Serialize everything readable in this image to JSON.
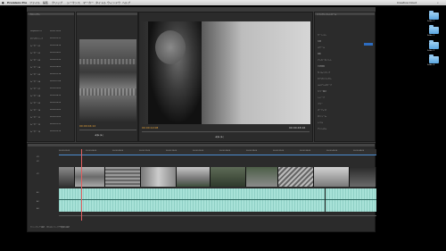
{
  "app": {
    "name": "Premiere Pro",
    "clock_label": "Creative Cloud"
  },
  "menu": [
    "ファイル",
    "編集",
    "クリップ",
    "シーケンス",
    "マーカー",
    "タイトル",
    "ウィンドウ",
    "ヘルプ"
  ],
  "desktop_folders": [
    "Folder 1",
    "Folder 2",
    "Folder 3",
    "Folder 4"
  ],
  "project_panel": {
    "title": "プロジェクト",
    "items": [
      "Sequence 01",
      "ビデオクリップ",
      "ムービー 01",
      "ムービー 02",
      "ムービー 03",
      "ムービー 04",
      "ムービー 05",
      "ムービー 06",
      "ムービー 07",
      "ムービー 08",
      "ムービー 09",
      "ムービー 10",
      "ムービー 11",
      "ムービー 12",
      "ムービー 13"
    ],
    "durations": [
      "00:00:10:00",
      "00:00:05:12",
      "00:00:04:18",
      "00:00:06:02",
      "00:00:03:20",
      "00:00:08:00",
      "00:00:02:14",
      "00:00:07:08",
      "00:00:05:00",
      "00:00:04:10",
      "00:00:06:20",
      "00:00:03:05",
      "00:00:09:00",
      "00:00:02:22",
      "00:00:05:16"
    ]
  },
  "source_monitor": {
    "timecode": "00:00:04:12"
  },
  "program_monitor": {
    "timecode": "00:00:12:08",
    "duration": "00:00:48:16"
  },
  "effects_panel": {
    "title": "エフェクトコントロール",
    "items": [
      "モーション",
      "位置",
      "スケール",
      "回転",
      "アンカーポイント",
      "不透明度",
      "タイムリマップ",
      "ビデオエフェクト",
      "ルミナンスカーブ",
      "カラー補正",
      "シャープ",
      "ブラー",
      "オーディオ",
      "ボリューム",
      "レベル",
      "チャンネル"
    ]
  },
  "timeline": {
    "ruler": [
      "00:00:00:00",
      "00:00:04:00",
      "00:00:08:00",
      "00:00:12:00",
      "00:00:16:00",
      "00:00:20:00",
      "00:00:24:00",
      "00:00:28:00",
      "00:00:32:00",
      "00:00:36:00",
      "00:00:40:00",
      "00:00:44:00"
    ],
    "tracks": [
      "V3",
      "V2",
      "V1",
      "A1",
      "A2",
      "A3"
    ],
    "status": "クリックして選択、またはドラッグで範囲を選択"
  }
}
